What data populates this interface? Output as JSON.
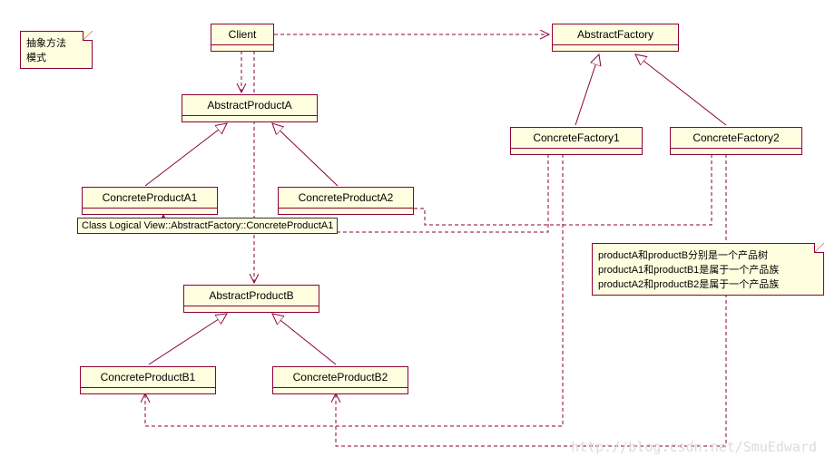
{
  "notes": {
    "top_left": {
      "line1": "抽象方法",
      "line2": "模式"
    },
    "right": {
      "line1": "productA和productB分别是一个产品树",
      "line2": "productA1和productB1是属于一个产品族",
      "line3": "productA2和productB2是属于一个产品族"
    }
  },
  "classes": {
    "client": "Client",
    "abstractFactory": "AbstractFactory",
    "abstractProductA": "AbstractProductA",
    "abstractProductB": "AbstractProductB",
    "concreteProductA1": "ConcreteProductA1",
    "concreteProductA2": "ConcreteProductA2",
    "concreteProductB1": "ConcreteProductB1",
    "concreteProductB2": "ConcreteProductB2",
    "concreteFactory1": "ConcreteFactory1",
    "concreteFactory2": "ConcreteFactory2"
  },
  "tooltip": "Class Logical View::AbstractFactory::ConcreteProductA1",
  "watermark": "http://blog.csdn.net/SmuEdward",
  "colors": {
    "stroke": "#8b0038",
    "fill": "#ffffe0"
  },
  "chart_data": {
    "type": "table",
    "title": "UML Class Diagram — Abstract Factory Pattern",
    "nodes": [
      {
        "id": "Client",
        "kind": "class"
      },
      {
        "id": "AbstractFactory",
        "kind": "abstract-class"
      },
      {
        "id": "ConcreteFactory1",
        "kind": "class"
      },
      {
        "id": "ConcreteFactory2",
        "kind": "class"
      },
      {
        "id": "AbstractProductA",
        "kind": "abstract-class"
      },
      {
        "id": "ConcreteProductA1",
        "kind": "class"
      },
      {
        "id": "ConcreteProductA2",
        "kind": "class"
      },
      {
        "id": "AbstractProductB",
        "kind": "abstract-class"
      },
      {
        "id": "ConcreteProductB1",
        "kind": "class"
      },
      {
        "id": "ConcreteProductB2",
        "kind": "class"
      }
    ],
    "edges": [
      {
        "from": "Client",
        "to": "AbstractFactory",
        "type": "dependency"
      },
      {
        "from": "Client",
        "to": "AbstractProductA",
        "type": "dependency"
      },
      {
        "from": "Client",
        "to": "AbstractProductB",
        "type": "dependency"
      },
      {
        "from": "ConcreteFactory1",
        "to": "AbstractFactory",
        "type": "generalization"
      },
      {
        "from": "ConcreteFactory2",
        "to": "AbstractFactory",
        "type": "generalization"
      },
      {
        "from": "ConcreteProductA1",
        "to": "AbstractProductA",
        "type": "generalization"
      },
      {
        "from": "ConcreteProductA2",
        "to": "AbstractProductA",
        "type": "generalization"
      },
      {
        "from": "ConcreteProductB1",
        "to": "AbstractProductB",
        "type": "generalization"
      },
      {
        "from": "ConcreteProductB2",
        "to": "AbstractProductB",
        "type": "generalization"
      },
      {
        "from": "ConcreteFactory1",
        "to": "ConcreteProductA1",
        "type": "dependency"
      },
      {
        "from": "ConcreteFactory1",
        "to": "ConcreteProductB1",
        "type": "dependency"
      },
      {
        "from": "ConcreteFactory2",
        "to": "ConcreteProductA2",
        "type": "dependency"
      },
      {
        "from": "ConcreteFactory2",
        "to": "ConcreteProductB2",
        "type": "dependency"
      }
    ],
    "notes": [
      {
        "text": "抽象方法模式"
      },
      {
        "text": "productA和productB分别是一个产品树; productA1和productB1是属于一个产品族; productA2和productB2是属于一个产品族"
      }
    ]
  }
}
